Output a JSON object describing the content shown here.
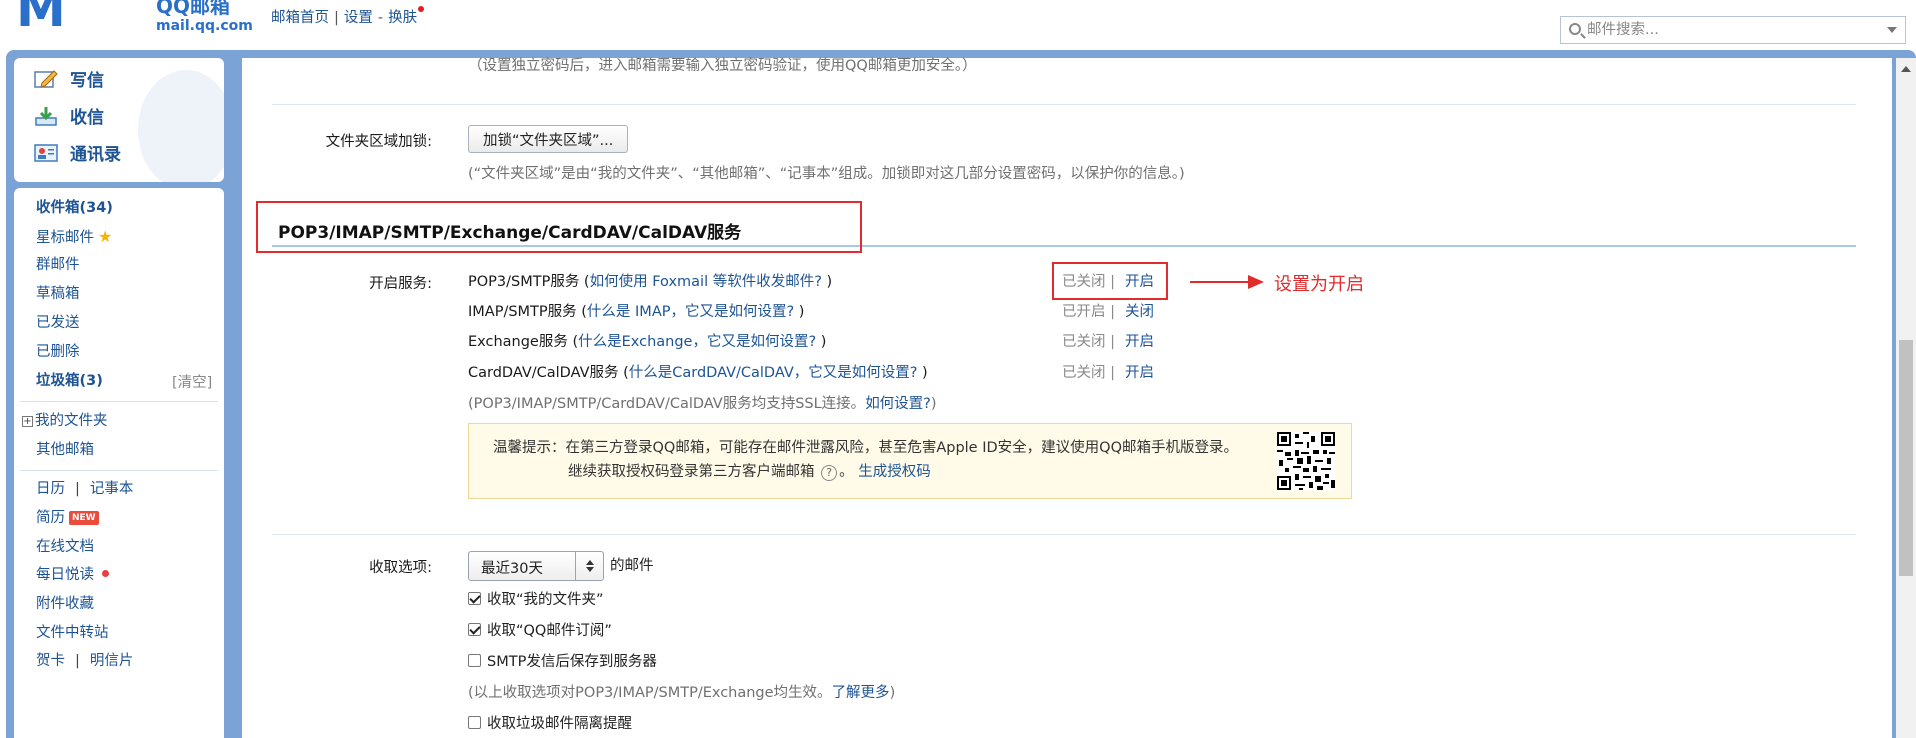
{
  "header": {
    "logo_text": "M",
    "brand_cn": "QQ邮箱",
    "brand_domain": "mail.qq.com",
    "links": [
      "邮箱首页",
      "设置",
      "换肤"
    ],
    "search_placeholder": "邮件搜索..."
  },
  "quick_actions": [
    "写信",
    "收信",
    "通讯录"
  ],
  "sidebar": {
    "inbox": "收件箱(34)",
    "starred": "星标邮件",
    "group": "群邮件",
    "drafts": "草稿箱",
    "sent": "已发送",
    "deleted": "已删除",
    "spam": "垃圾箱(3)",
    "spam_clear": "[清空]",
    "my_folders": "我的文件夹",
    "other_mailbox": "其他邮箱",
    "calendar": "日历",
    "notes": "记事本",
    "resume": "简历",
    "new_badge": "NEW",
    "online_docs": "在线文档",
    "daily_read": "每日悦读",
    "attachments": "附件收藏",
    "file_transfer": "文件中转站",
    "greeting_card": "贺卡",
    "postcard": "明信片"
  },
  "main": {
    "top_note": "（设置独立密码后，进入邮箱需要输入独立密码验证，使用QQ邮箱更加安全。）",
    "folder_lock_label": "文件夹区域加锁:",
    "folder_lock_button": "加锁“文件夹区域”...",
    "folder_lock_note": "(“文件夹区域”是由“我的文件夹”、“其他邮箱”、“记事本”组成。加锁即对这几部分设置密码，以保护你的信息。)",
    "section_title": "POP3/IMAP/SMTP/Exchange/CardDAV/CalDAV服务",
    "enable_label": "开启服务:",
    "services": [
      {
        "name": "POP3/SMTP服务 (",
        "link": "如何使用 Foxmail 等软件收发邮件?",
        "close": " )",
        "status": "已关闭",
        "toggle": "开启"
      },
      {
        "name": "IMAP/SMTP服务 (",
        "link": "什么是 IMAP，它又是如何设置?",
        "close": " )",
        "status": "已开启",
        "toggle": "关闭"
      },
      {
        "name": "Exchange服务 (",
        "link": "什么是Exchange，它又是如何设置?",
        "close": " )",
        "status": "已关闭",
        "toggle": "开启"
      },
      {
        "name": "CardDAV/CalDAV服务 (",
        "link": "什么是CardDAV/CalDAV，它又是如何设置?",
        "close": " )",
        "status": "已关闭",
        "toggle": "开启"
      }
    ],
    "ssl_note": "(POP3/IMAP/SMTP/CardDAV/CalDAV服务均支持SSL连接。",
    "ssl_link": "如何设置?",
    "ssl_close": ")",
    "tip_line1": "温馨提示：在第三方登录QQ邮箱，可能存在邮件泄露风险，甚至危害Apple ID安全，建议使用QQ邮箱手机版登录。",
    "tip_line2": "继续获取授权码登录第三方客户端邮箱",
    "tip_help": "?",
    "tip_link": "生成授权码",
    "receive_label": "收取选项:",
    "receive_select": "最近30天",
    "receive_suffix": "的邮件",
    "opt1": "收取“我的文件夹”",
    "opt2": "收取“QQ邮件订阅”",
    "opt3": "SMTP发信后保存到服务器",
    "opt_note": "(以上收取选项对POP3/IMAP/SMTP/Exchange均生效。",
    "opt_note_link": "了解更多",
    "opt_note_close": ")",
    "opt4": "收取垃圾邮件隔离提醒"
  },
  "annotation": {
    "text": "设置为开启"
  },
  "colors": {
    "frame_blue": "#7ba3d6",
    "link_blue": "#1e5494",
    "annotation_red": "#e02c2c"
  }
}
